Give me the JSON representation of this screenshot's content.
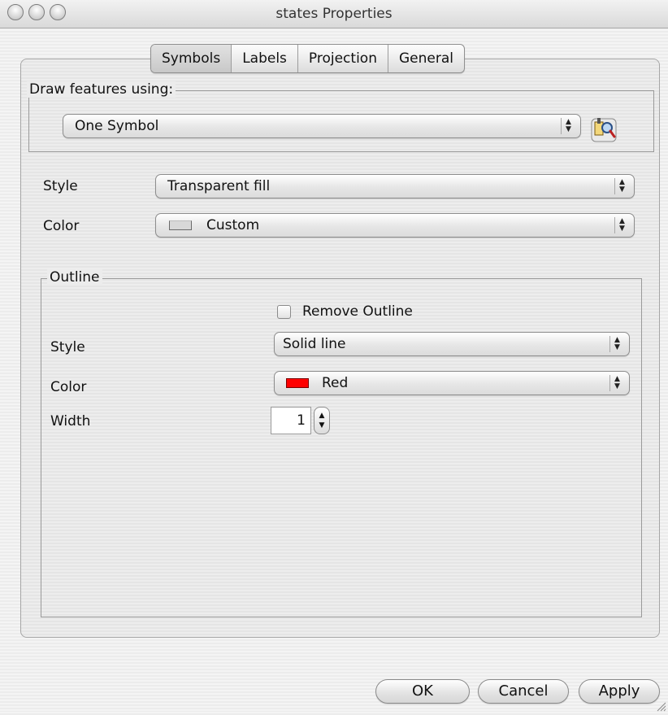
{
  "window": {
    "title": "states Properties"
  },
  "tabs": [
    {
      "label": "Symbols",
      "active": true
    },
    {
      "label": "Labels",
      "active": false
    },
    {
      "label": "Projection",
      "active": false
    },
    {
      "label": "General",
      "active": false
    }
  ],
  "draw_features": {
    "legend": "Draw features using:",
    "selected": "One Symbol",
    "style_picker_icon": "style-picker-icon"
  },
  "fill": {
    "style_label": "Style",
    "style_value": "Transparent fill",
    "color_label": "Color",
    "color_value": "Custom",
    "color_swatch": "#d8d8d8"
  },
  "outline": {
    "legend": "Outline",
    "remove_outline_label": "Remove Outline",
    "remove_outline_checked": false,
    "style_label": "Style",
    "style_value": "Solid line",
    "color_label": "Color",
    "color_value": "Red",
    "color_swatch": "#ff0000",
    "width_label": "Width",
    "width_value": "1"
  },
  "buttons": {
    "ok": "OK",
    "cancel": "Cancel",
    "apply": "Apply"
  }
}
